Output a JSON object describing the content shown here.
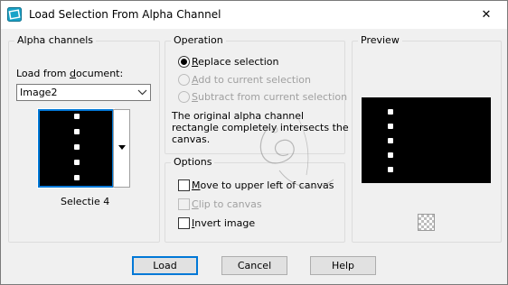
{
  "window": {
    "title": "Load Selection From Alpha Channel",
    "close_glyph": "✕"
  },
  "alpha_channels": {
    "group_label": "Alpha channels",
    "load_from_label_pre": "Load from ",
    "load_from_label_hotkey": "d",
    "load_from_label_post": "ocument:",
    "document_value": "Image2",
    "channel_name": "Selectie 4"
  },
  "operation": {
    "group_label": "Operation",
    "options": [
      {
        "hotkey": "R",
        "rest": "eplace selection",
        "selected": true,
        "enabled": true
      },
      {
        "hotkey": "A",
        "rest": "dd to current selection",
        "selected": false,
        "enabled": false
      },
      {
        "hotkey": "S",
        "rest": "ubtract from current selection",
        "selected": false,
        "enabled": false
      }
    ],
    "info_line1": "The original alpha channel",
    "info_line2": "rectangle completely intersects the",
    "info_line3": "canvas."
  },
  "options": {
    "group_label": "Options",
    "move_pre": "",
    "move_hotkey": "M",
    "move_rest": "ove to upper left of canvas",
    "move_checked": false,
    "clip_pre": "",
    "clip_hotkey": "C",
    "clip_rest": "lip to canvas",
    "clip_checked": false,
    "clip_enabled": false,
    "invert_pre": "",
    "invert_hotkey": "I",
    "invert_rest": "nvert image",
    "invert_checked": false
  },
  "preview": {
    "group_label": "Preview"
  },
  "buttons": {
    "load": "Load",
    "cancel": "Cancel",
    "help": "Help"
  },
  "colors": {
    "accent": "#0078d7",
    "canvas": "#000000",
    "disabled": "#a0a0a0"
  },
  "icons": {
    "app": "psp-app-icon",
    "close": "close-icon",
    "dropdown": "chevron-down-icon",
    "preview_toggle": "checkerboard-icon"
  }
}
